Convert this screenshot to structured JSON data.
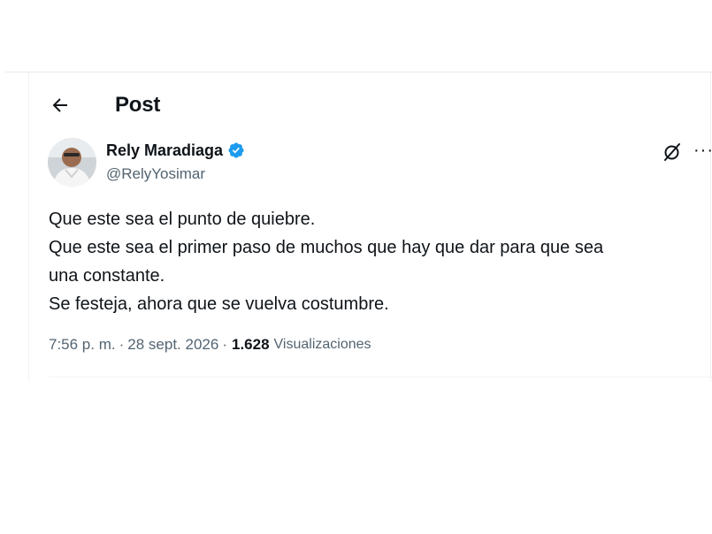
{
  "header": {
    "back_icon": "arrow-left-icon",
    "title": "Post"
  },
  "author": {
    "display_name": "Rely Maradiaga",
    "handle": "@RelyYosimar",
    "verified": true,
    "verified_color": "#1d9bf0"
  },
  "tweet": {
    "lines": [
      "Que este sea el punto de quiebre.",
      "Que este sea el primer paso de muchos que hay que dar para que sea",
      "una constante.",
      "Se festeja, ahora que se vuelva costumbre."
    ]
  },
  "meta": {
    "time": "7:56 p. m.",
    "separator": "·",
    "date": "28 sept. 2026",
    "views_count": "1.628",
    "views_label": "Visualizaciones"
  },
  "icons": {
    "grok": "grok-icon",
    "more": "more-options-icon"
  },
  "colors": {
    "text_primary": "#0f1419",
    "text_secondary": "#536471",
    "border": "#eff3f4",
    "accent": "#1d9bf0"
  }
}
